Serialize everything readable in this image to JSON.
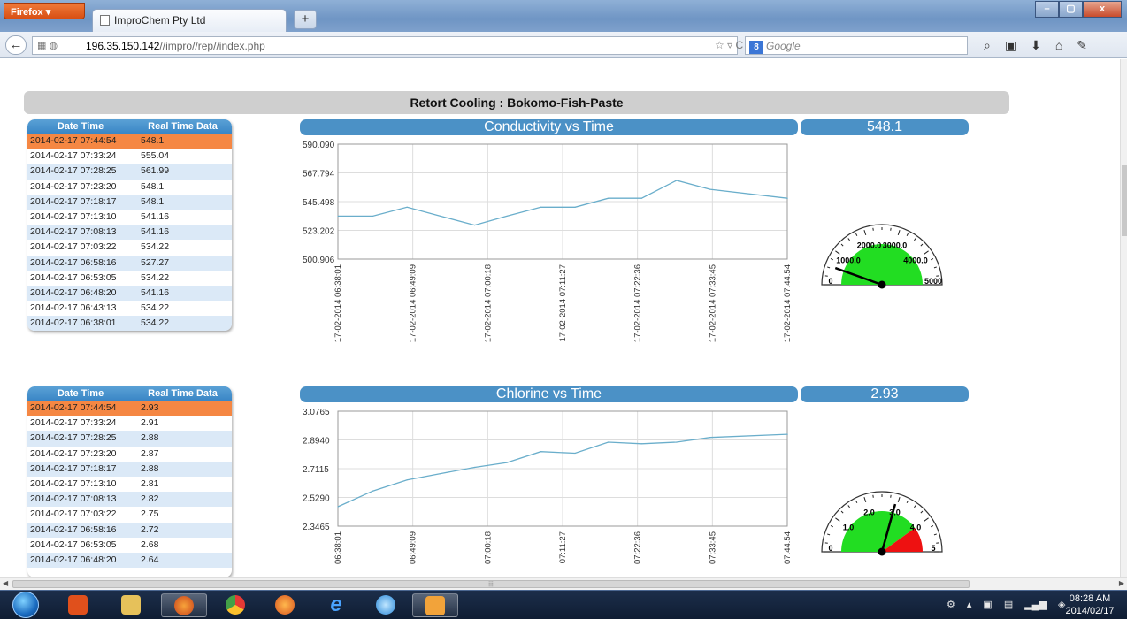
{
  "browser": {
    "menu_label": "Firefox ▾",
    "tab_title": "ImproChem Pty Ltd",
    "new_tab": "+",
    "url_host": "196.35.150.142",
    "url_path": "//impro//rep//index.php",
    "search_placeholder": "Google",
    "window_controls": {
      "minimize": "–",
      "maximize": "▢",
      "close": "x"
    }
  },
  "page": {
    "title": "Retort Cooling : Bokomo-Fish-Paste"
  },
  "table_headers": {
    "datetime": "Date Time",
    "value": "Real Time Data"
  },
  "conductivity": {
    "title": "Conductivity vs Time",
    "current_value": "548.1",
    "rows": [
      [
        "2014-02-17 07:44:54",
        "548.1"
      ],
      [
        "2014-02-17 07:33:24",
        "555.04"
      ],
      [
        "2014-02-17 07:28:25",
        "561.99"
      ],
      [
        "2014-02-17 07:23:20",
        "548.1"
      ],
      [
        "2014-02-17 07:18:17",
        "548.1"
      ],
      [
        "2014-02-17 07:13:10",
        "541.16"
      ],
      [
        "2014-02-17 07:08:13",
        "541.16"
      ],
      [
        "2014-02-17 07:03:22",
        "534.22"
      ],
      [
        "2014-02-17 06:58:16",
        "527.27"
      ],
      [
        "2014-02-17 06:53:05",
        "534.22"
      ],
      [
        "2014-02-17 06:48:20",
        "541.16"
      ],
      [
        "2014-02-17 06:43:13",
        "534.22"
      ],
      [
        "2014-02-17 06:38:01",
        "534.22"
      ]
    ],
    "chart_data": {
      "type": "line",
      "y_ticks": [
        "590.090",
        "567.794",
        "545.498",
        "523.202",
        "500.906"
      ],
      "ylim": [
        500.906,
        590.09
      ],
      "x_ticks": [
        "17-02-2014 06:38:01",
        "17-02-2014 06:49:09",
        "17-02-2014 07:00:18",
        "17-02-2014 07:11:27",
        "17-02-2014 07:22:36",
        "17-02-2014 07:33:45",
        "17-02-2014 07:44:54"
      ],
      "x_minutes": [
        0,
        5.2,
        10.3,
        15.25,
        20.35,
        25.15,
        30.2,
        35.3,
        40.25,
        45.2,
        50.4,
        55.4,
        66.9
      ],
      "values": [
        534.22,
        534.22,
        541.16,
        534.22,
        527.27,
        534.22,
        541.16,
        541.16,
        548.1,
        548.1,
        561.99,
        555.04,
        548.1
      ],
      "x_range_minutes": [
        0,
        66.88
      ]
    },
    "gauge": {
      "value": 548.1,
      "max": 5000,
      "labels": [
        "0",
        "1000.0",
        "2000.0",
        "3000.0",
        "4000.0",
        "5000"
      ],
      "green_to": 5000,
      "red_from": null
    }
  },
  "chlorine": {
    "title": "Chlorine vs Time",
    "current_value": "2.93",
    "rows": [
      [
        "2014-02-17 07:44:54",
        "2.93"
      ],
      [
        "2014-02-17 07:33:24",
        "2.91"
      ],
      [
        "2014-02-17 07:28:25",
        "2.88"
      ],
      [
        "2014-02-17 07:23:20",
        "2.87"
      ],
      [
        "2014-02-17 07:18:17",
        "2.88"
      ],
      [
        "2014-02-17 07:13:10",
        "2.81"
      ],
      [
        "2014-02-17 07:08:13",
        "2.82"
      ],
      [
        "2014-02-17 07:03:22",
        "2.75"
      ],
      [
        "2014-02-17 06:58:16",
        "2.72"
      ],
      [
        "2014-02-17 06:53:05",
        "2.68"
      ],
      [
        "2014-02-17 06:48:20",
        "2.64"
      ]
    ],
    "chart_data": {
      "type": "line",
      "y_ticks": [
        "3.0765",
        "2.8940",
        "2.7115",
        "2.5290",
        "2.3465"
      ],
      "ylim": [
        2.3465,
        3.0765
      ],
      "x_ticks": [
        "06:38:01",
        "06:49:09",
        "07:00:18",
        "07:11:27",
        "07:22:36",
        "07:33:45",
        "07:44:54"
      ],
      "x_minutes": [
        0,
        5.2,
        10.3,
        15.25,
        20.35,
        25.15,
        30.2,
        35.3,
        40.25,
        45.2,
        50.4,
        55.4,
        66.9
      ],
      "values": [
        2.47,
        2.57,
        2.64,
        2.68,
        2.72,
        2.75,
        2.82,
        2.81,
        2.88,
        2.87,
        2.88,
        2.91,
        2.93
      ],
      "x_range_minutes": [
        0,
        66.88
      ]
    },
    "gauge": {
      "value": 2.93,
      "max": 5,
      "labels": [
        "0",
        "1.0",
        "2.0",
        "3.0",
        "4.0",
        "5"
      ],
      "green_to": 4,
      "red_from": 4
    }
  },
  "colors": {
    "header_blue": "#4b91c6",
    "highlight_row": "#f58743",
    "line": "#6aaecb",
    "gauge_green": "#22dd22",
    "gauge_red": "#ee1111"
  },
  "taskbar": {
    "time": "08:28 AM",
    "date": "2014/02/17"
  }
}
